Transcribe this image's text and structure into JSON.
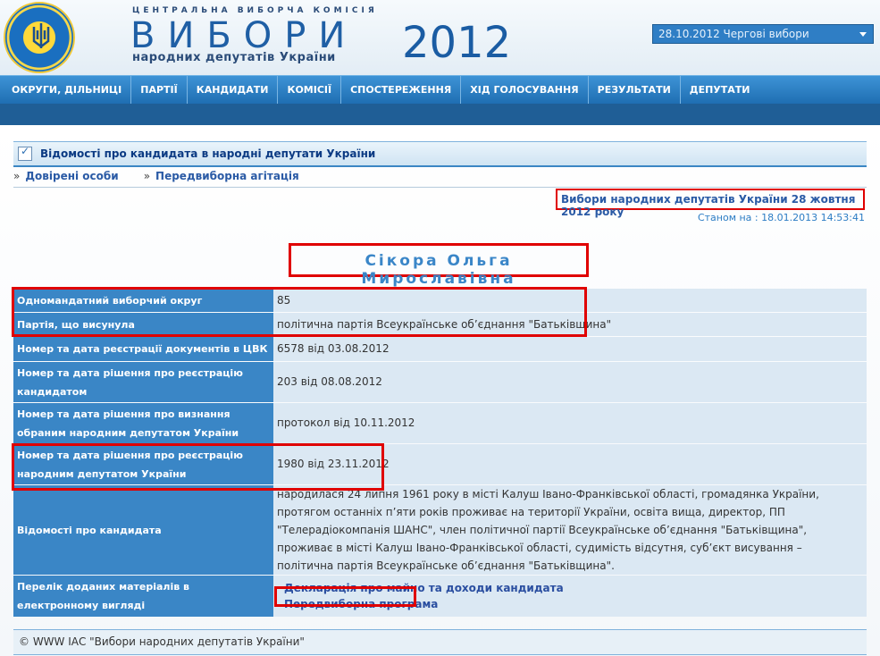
{
  "header": {
    "commission": "ЦЕНТРАЛЬНА ВИБОРЧА КОМІСІЯ",
    "title": "ВИБОРИ",
    "subtitle": "народних депутатів України",
    "year": "2012",
    "election_select": "28.10.2012 Чергові вибори"
  },
  "nav": {
    "items": [
      "ОКРУГИ, ДІЛЬНИЦІ",
      "ПАРТІЇ",
      "КАНДИДАТИ",
      "КОМІСІЇ",
      "СПОСТЕРЕЖЕННЯ",
      "ХІД ГОЛОСУВАННЯ",
      "РЕЗУЛЬТАТИ",
      "ДЕПУТАТИ"
    ]
  },
  "page": {
    "section_title": "Відомості про кандидата в народні депутати України",
    "crumb_sep": "»",
    "crumbs": [
      "Довірені особи",
      "Передвиборна агітація"
    ],
    "election_link": "Вибори народних депутатів України 28 жовтня 2012 року",
    "as_of": "Станом на : 18.01.2013 14:53:41",
    "candidate_name": "Сікора Ольга Мирославівна"
  },
  "table": {
    "rows": [
      {
        "k": "Одномандатний виборчий округ",
        "v": "85"
      },
      {
        "k": "Партія, що висунула",
        "v": "політична партія Всеукраїнське об’єднання \"Батьківщина\""
      },
      {
        "k": "Номер та дата реєстрації документів в ЦВК",
        "v": "6578 від 03.08.2012"
      },
      {
        "k": "Номер та дата рішення про реєстрацію кандидатом",
        "v": "203 від 08.08.2012"
      },
      {
        "k": "Номер та дата рішення про визнання обраним народним депутатом України",
        "v": "протокол від 10.11.2012"
      },
      {
        "k": "Номер та дата рішення про реєстрацію народним депутатом України",
        "v": "1980 від 23.11.2012"
      },
      {
        "k": "Відомості про кандидата",
        "v": "народилася 24 липня 1961 року в місті Калуш Івано-Франківської області, громадянка України, протягом останніх п’яти років проживає на території України, освіта вища, директор, ПП \"Телерадіокомпанія ШАНС\", член політичної партії Всеукраїнське об’єднання \"Батьківщина\", проживає в місті Калуш Івано-Франківської області, судимість відсутня, суб’єкт висування – політична партія Всеукраїнське об’єднання \"Батьківщина\"."
      },
      {
        "k": "Перелік доданих матеріалів в електронному вигляді",
        "v": ""
      }
    ],
    "materials": [
      "Декларація про майно та доходи кандидата",
      "Передвиборна програма"
    ]
  },
  "footer": {
    "text": "© WWW ІАС \"Вибори народних депутатів України\""
  },
  "colors": {
    "accent_blue": "#3a86c6",
    "nav_blue": "#2f7ec5",
    "highlight_red": "#e00000",
    "cell_bg": "#dbe8f3"
  }
}
